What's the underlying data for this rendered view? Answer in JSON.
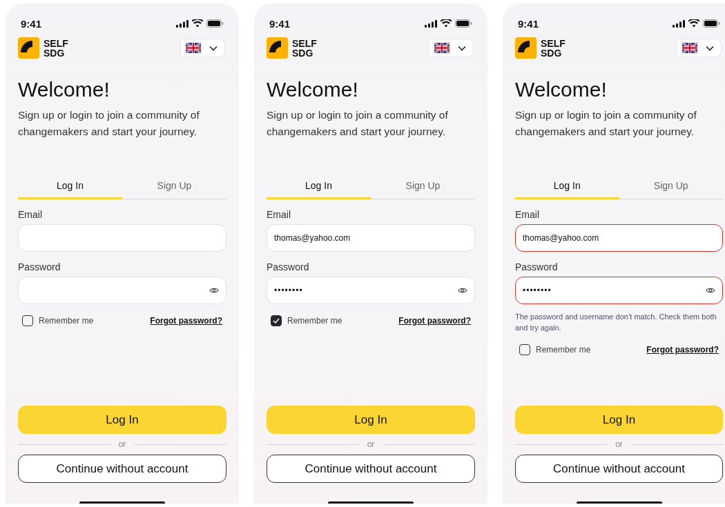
{
  "screens": [
    {
      "status": {
        "time": "9:41"
      },
      "brand": {
        "line1": "SELF",
        "line2": "SDG"
      },
      "title": "Welcome!",
      "subtitle": "Sign up or login to join a community of changemakers and start your journey.",
      "tabs": [
        {
          "label": "Log In",
          "selected": true
        },
        {
          "label": "Sign Up",
          "selected": false
        }
      ],
      "fields": [
        {
          "label": "Email",
          "kind": "text",
          "invalid": false
        },
        {
          "label": "Password",
          "kind": "password",
          "invalid": false
        }
      ],
      "remember": {
        "label": "Remember me",
        "checked": false
      },
      "forgot": "Forgot password?",
      "login_button": "Log In",
      "divider": "or",
      "guest_button": "Continue without account"
    },
    {
      "status": {
        "time": "9:41"
      },
      "brand": {
        "line1": "SELF",
        "line2": "SDG"
      },
      "title": "Welcome!",
      "subtitle": "Sign up or login to join a community of changemakers and start your journey.",
      "tabs": [
        {
          "label": "Log In",
          "selected": true
        },
        {
          "label": "Sign Up",
          "selected": false
        }
      ],
      "fields": [
        {
          "label": "Email",
          "kind": "text",
          "value": "thomas@yahoo.com",
          "invalid": false
        },
        {
          "label": "Password",
          "kind": "password",
          "value": "••••••••",
          "invalid": false
        }
      ],
      "remember": {
        "label": "Remember me",
        "checked": true
      },
      "forgot": "Forgot password?",
      "login_button": "Log In",
      "divider": "or",
      "guest_button": "Continue without account"
    },
    {
      "status": {
        "time": "9:41"
      },
      "brand": {
        "line1": "SELF",
        "line2": "SDG"
      },
      "title": "Welcome!",
      "subtitle": "Sign up or login to join a community of changemakers and start your journey.",
      "tabs": [
        {
          "label": "Log In",
          "selected": true
        },
        {
          "label": "Sign Up",
          "selected": false
        }
      ],
      "fields": [
        {
          "label": "Email",
          "kind": "text",
          "value": "thomas@yahoo.com",
          "invalid": true
        },
        {
          "label": "Password",
          "kind": "password",
          "value": "••••••••",
          "invalid": true
        }
      ],
      "error": "The password and username don’t match. Check them both and try again.",
      "remember": {
        "label": "Remember me",
        "checked": false
      },
      "forgot": "Forgot password?",
      "login_button": "Log In",
      "divider": "or",
      "guest_button": "Continue without account"
    }
  ]
}
